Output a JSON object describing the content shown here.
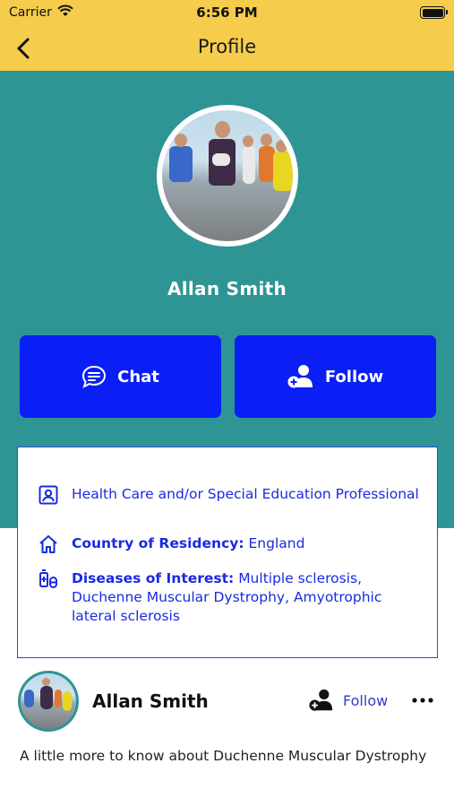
{
  "status_bar": {
    "carrier": "Carrier",
    "time": "6:56 PM",
    "battery_level": 1.0
  },
  "nav": {
    "title": "Profile",
    "back_icon": "chevron-left-icon"
  },
  "profile": {
    "name": "Allan Smith",
    "chat_label": "Chat",
    "follow_label": "Follow"
  },
  "info": {
    "occupation": "Health Care and/or Special Education Professional",
    "residency_label": "Country of Residency:",
    "residency_value": "England",
    "diseases_label": "Diseases of Interest:",
    "diseases_value": "Multiple sclerosis, Duchenne Muscular Dystrophy, Amyotrophic lateral sclerosis"
  },
  "post": {
    "author": "Allan Smith",
    "follow_label": "Follow",
    "text": "A little more to know about Duchenne Muscular Dystrophy"
  },
  "colors": {
    "header_yellow": "#f5cc4b",
    "hero_teal": "#2e9494",
    "button_blue": "#0a1ff5",
    "link_blue": "#1a2ae0"
  }
}
